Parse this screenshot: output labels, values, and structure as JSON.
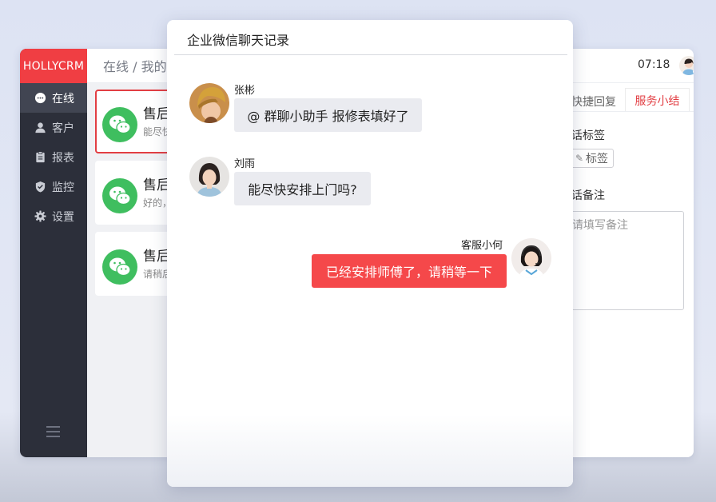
{
  "crm": {
    "logo": "HOLLYCRM",
    "breadcrumb": "在线 / 我的",
    "clock": "07:18",
    "nav": [
      {
        "label": "在线",
        "icon": "chat-bubble-icon",
        "active": true
      },
      {
        "label": "客户",
        "icon": "user-icon",
        "active": false
      },
      {
        "label": "报表",
        "icon": "clipboard-icon",
        "active": false
      },
      {
        "label": "监控",
        "icon": "shield-icon",
        "active": false
      },
      {
        "label": "设置",
        "icon": "gear-icon",
        "active": false
      }
    ],
    "sessions": [
      {
        "title": "售后",
        "snippet": "能尽快",
        "active": true,
        "icon": "wechat-icon"
      },
      {
        "title": "售后",
        "snippet": "好的，",
        "active": false,
        "icon": "wechat-icon"
      },
      {
        "title": "售后",
        "snippet": "请稍后",
        "active": false,
        "icon": "wechat-icon"
      }
    ],
    "right_panel": {
      "tabs": [
        {
          "label": "快捷回复",
          "active": false
        },
        {
          "label": "服务小结",
          "active": true
        }
      ],
      "session_tags_label": "话标签",
      "tag_button": "标签",
      "session_notes_label": "话备注",
      "notes_placeholder": "请填写备注"
    }
  },
  "dialog": {
    "title": "企业微信聊天记录",
    "messages": [
      {
        "sender": "张彬",
        "text": "@ 群聊小助手  报修表填好了",
        "direction": "in",
        "avatar": "avatar-zhangbin"
      },
      {
        "sender": "刘雨",
        "text": "能尽快安排上门吗?",
        "direction": "in",
        "avatar": "avatar-liuyu"
      },
      {
        "sender": "客服小何",
        "text": "已经安排师傅了，请稍等一下",
        "direction": "out",
        "avatar": "avatar-agent"
      }
    ]
  },
  "colors": {
    "brand_red": "#f03e43",
    "sidebar_dark": "#2c2f3a",
    "wechat_green": "#3fbe5f",
    "outgoing_bubble": "#f5484a",
    "incoming_bubble": "#eaebf0"
  }
}
